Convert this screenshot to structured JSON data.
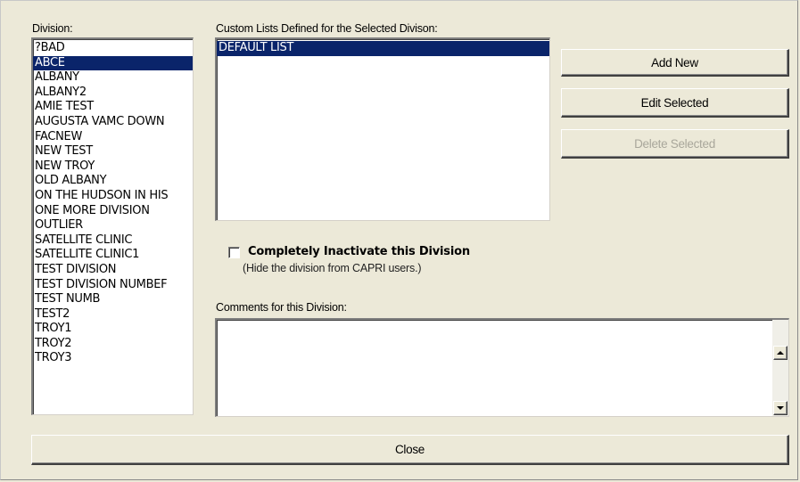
{
  "division": {
    "label": "Division:",
    "items": [
      "?BAD",
      "ABCE",
      "ALBANY",
      "ALBANY2",
      "AMIE TEST",
      "AUGUSTA VAMC DOWN",
      "FACNEW",
      "NEW TEST",
      "NEW TROY",
      "OLD ALBANY",
      "ON THE HUDSON IN HIS",
      "ONE MORE DIVISION",
      "OUTLIER",
      "SATELLITE CLINIC",
      "SATELLITE CLINIC1",
      "TEST DIVISION",
      "TEST DIVISION NUMBEF",
      "TEST NUMB",
      "TEST2",
      "TROY1",
      "TROY2",
      "TROY3"
    ],
    "selected_index": 1
  },
  "custom_lists": {
    "label": "Custom Lists Defined for the Selected Divison:",
    "items": [
      "DEFAULT LIST"
    ],
    "selected_index": 0
  },
  "buttons": {
    "add_new": "Add New",
    "edit_selected": "Edit Selected",
    "delete_selected": "Delete Selected",
    "close": "Close"
  },
  "inactivate": {
    "label": "Completely Inactivate this Division",
    "hint": "(Hide the division from CAPRI users.)",
    "checked": false
  },
  "comments": {
    "label": "Comments for this Division:",
    "value": ""
  },
  "colors": {
    "dialog_bg": "#ece9d8",
    "selection_bg": "#0a246a",
    "disabled_text": "#a9a79b"
  }
}
